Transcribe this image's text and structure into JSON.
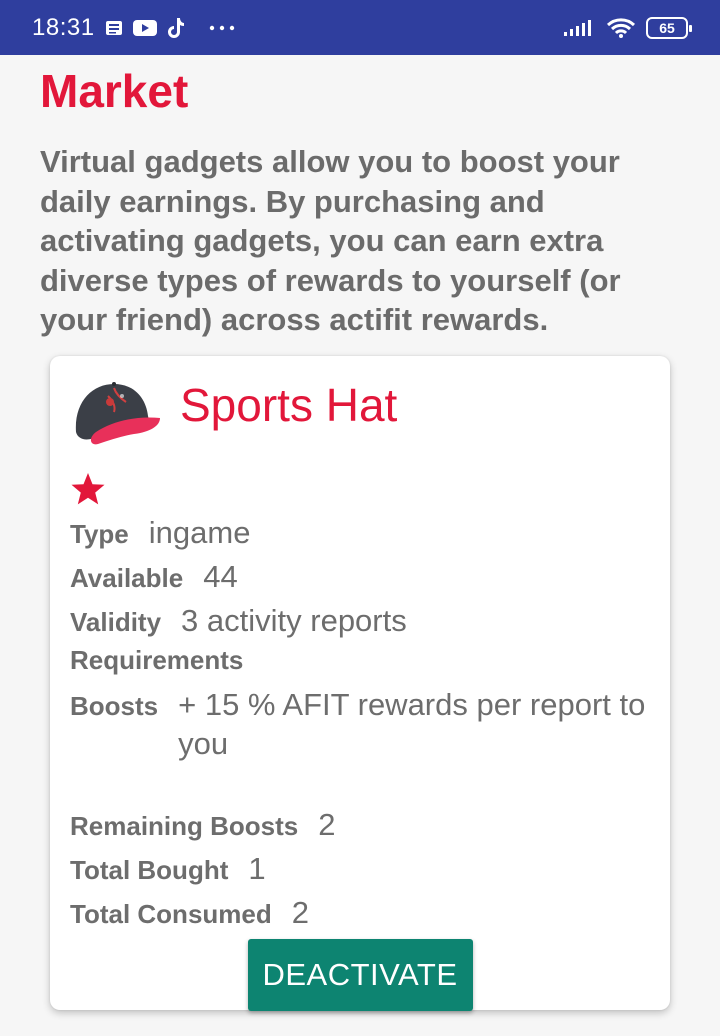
{
  "status_bar": {
    "time": "18:31",
    "battery": "65",
    "icons": [
      "news-icon",
      "youtube-icon",
      "tiktok-icon",
      "more-dots-icon",
      "signal-icon",
      "wifi-icon",
      "battery-icon"
    ]
  },
  "page": {
    "title": "Market",
    "intro": "Virtual gadgets allow you to boost your daily earnings. By purchasing and activating gadgets, you can earn extra diverse types of rewards to yourself (or your friend) across actifit rewards."
  },
  "item": {
    "name": "Sports Hat",
    "icon": "sports-cap-icon",
    "star_icon": "star-icon",
    "type_label": "Type",
    "type_value": "ingame",
    "available_label": "Available",
    "available_value": "44",
    "validity_label": "Validity",
    "validity_value": "3 activity reports",
    "requirements_label": "Requirements",
    "boosts_label": "Boosts",
    "boosts_value": "+ 15 % AFIT rewards per report to you",
    "remaining_label": "Remaining Boosts",
    "remaining_value": "2",
    "bought_label": "Total Bought",
    "bought_value": "1",
    "consumed_label": "Total Consumed",
    "consumed_value": "2",
    "button_label": "DEACTIVATE"
  },
  "colors": {
    "status_bar": "#2f3e9e",
    "accent_red": "#e2173a",
    "button_teal": "#0d8471",
    "text_gray": "#6b6b6b"
  }
}
